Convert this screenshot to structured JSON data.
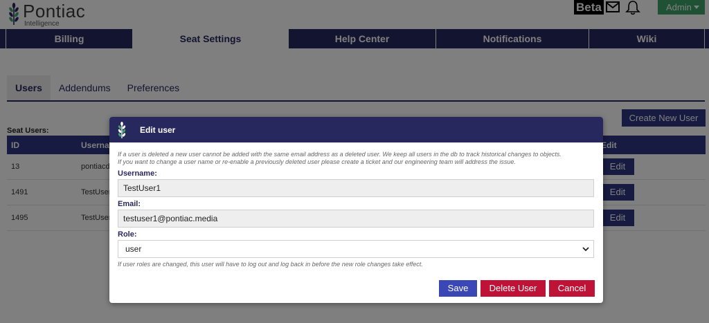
{
  "header": {
    "logo_name": "Pontiac",
    "logo_sub": "Intelligence",
    "beta": "Beta",
    "admin": "Admin"
  },
  "main_nav": [
    {
      "label": "Billing"
    },
    {
      "label": "Seat Settings"
    },
    {
      "label": "Help Center"
    },
    {
      "label": "Notifications"
    },
    {
      "label": "Wiki"
    }
  ],
  "sub_tabs": [
    {
      "label": "Users"
    },
    {
      "label": "Addendums"
    },
    {
      "label": "Preferences"
    }
  ],
  "create_button": "Create New User",
  "seat_users_title": "Seat Users:",
  "table": {
    "headers": [
      "ID",
      "Userna",
      "Edit"
    ],
    "rows": [
      {
        "id": "13",
        "username": "pontiacde"
      },
      {
        "id": "1491",
        "username": "TestUser"
      },
      {
        "id": "1495",
        "username": "TestUser"
      }
    ],
    "edit_label": "Edit"
  },
  "modal": {
    "title": "Edit user",
    "note_line1": "If a user is deleted a new user cannot be added with the same email address as a deleted user. We keep all users in the db to track historical changes to objects.",
    "note_line2": "If you want to change a user name or re-enable a previously deleted user please create a ticket and our engineering team will address the issue.",
    "username_label": "Username:",
    "username_value": "TestUser1",
    "email_label": "Email:",
    "email_value": "testuser1@pontiac.media",
    "role_label": "Role:",
    "role_value": "user",
    "role_note": "If user roles are changed, this user will have to log out and log back in before the new role changes take effect.",
    "save": "Save",
    "delete": "Delete User",
    "cancel": "Cancel"
  },
  "colors": {
    "navy": "#27285e",
    "button_blue": "#2e3583",
    "save_blue": "#3b47b5",
    "danger": "#be1237",
    "admin_green": "#3fa568"
  }
}
